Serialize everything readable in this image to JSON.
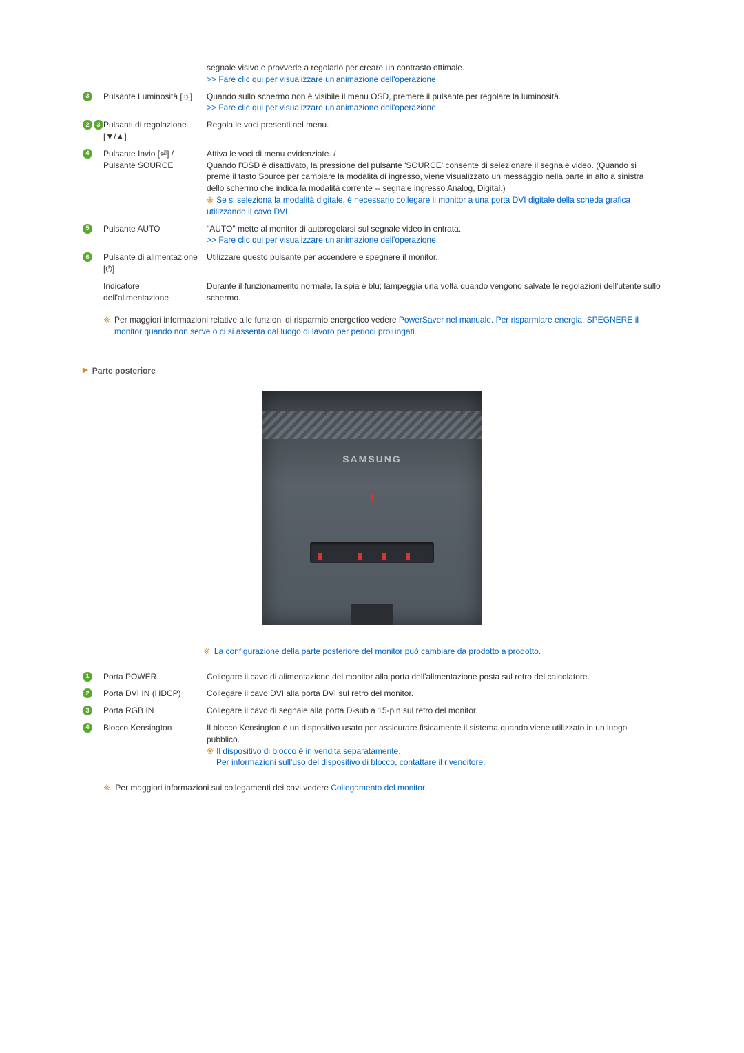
{
  "front_items": [
    {
      "num_display": "",
      "label": "",
      "desc_plain": "segnale visivo e provvede a regolarlo per creare un contrasto ottimale.",
      "desc_link": ">> Fare clic qui per visualizzare un'animazione dell'operazione."
    },
    {
      "num_display": "3",
      "label": "Pulsante Luminosità [☼]",
      "desc_plain": "Quando sullo schermo non è visibile il menu OSD, premere il pulsante per regolare la luminosità.",
      "desc_link": ">> Fare clic qui per visualizzare un'animazione dell'operazione."
    },
    {
      "num_display": "2,3",
      "label": "Pulsanti di regolazione [▼/▲]",
      "desc_plain": "Regola le voci presenti nel menu.",
      "desc_link": ""
    },
    {
      "num_display": "4",
      "label": "Pulsante Invio [⏎] / Pulsante SOURCE",
      "desc_plain": "Attiva le voci di menu evidenziate. /\nQuando l'OSD è disattivato, la pressione del pulsante 'SOURCE' consente di selezionare il segnale video. (Quando si preme il tasto Source per cambiare la modalità di ingresso, viene visualizzato un messaggio nella parte in alto a sinistra dello schermo che indica la modalità corrente -- segnale ingresso Analog, Digital.)",
      "note": "Se si seleziona la modalità digitale, è necessario collegare il monitor a una porta DVI digitale della scheda grafica utilizzando il cavo DVI.",
      "desc_link": ""
    },
    {
      "num_display": "5",
      "label": "Pulsante AUTO",
      "desc_plain": "\"AUTO\" mette al monitor di autoregolarsi sul segnale video in entrata.",
      "desc_link": ">> Fare clic qui per visualizzare un'animazione dell'operazione."
    },
    {
      "num_display": "6",
      "label": "Pulsante di alimentazione [⏻]",
      "desc_plain": "Utilizzare questo pulsante per accendere e spegnere il monitor.",
      "desc_link": ""
    },
    {
      "num_display": "",
      "label": "Indicatore dell'alimentazione",
      "desc_plain": "Durante il funzionamento normale, la spia è blu; lampeggia una volta quando vengono salvate le regolazioni dell'utente sullo schermo.",
      "desc_link": ""
    }
  ],
  "energy_note": {
    "plain1": "Per maggiori informazioni relative alle funzioni di risparmio energetico vedere",
    "link": "PowerSaver nel manuale. Per risparmiare energia, SPEGNERE il monitor quando non serve o ci si assenta dal luogo di lavoro per periodi prolungati.",
    "plain2": ""
  },
  "rear_header": "Parte posteriore",
  "monitor_brand": "SAMSUNG",
  "config_note": "La configurazione della parte posteriore del monitor può cambiare da prodotto a prodotto.",
  "rear_items": [
    {
      "num": "1",
      "label": "Porta POWER",
      "desc_plain": "Collegare il cavo di alimentazione del monitor alla porta dell'alimentazione posta sul retro del calcolatore.",
      "note": "",
      "note2": ""
    },
    {
      "num": "2",
      "label": "Porta DVI IN (HDCP)",
      "desc_plain": "Collegare il cavo DVI alla porta DVI sul retro del monitor.",
      "note": "",
      "note2": ""
    },
    {
      "num": "3",
      "label": "Porta RGB IN",
      "desc_plain": "Collegare il cavo di segnale alla porta D-sub a 15-pin sul retro del monitor.",
      "note": "",
      "note2": ""
    },
    {
      "num": "4",
      "label": "Blocco Kensington",
      "desc_plain": "Il blocco Kensington è un dispositivo usato per assicurare fisicamente il sistema quando viene utilizzato in un luogo pubblico.",
      "note": "Il dispositivo di blocco è in vendita separatamente.",
      "note2": "Per informazioni sull'uso del dispositivo di blocco, contattare il rivenditore."
    }
  ],
  "footer_note": {
    "plain": "Per maggiori informazioni sui collegamenti dei cavi vedere ",
    "link": "Collegamento del monitor",
    "suffix": "."
  }
}
